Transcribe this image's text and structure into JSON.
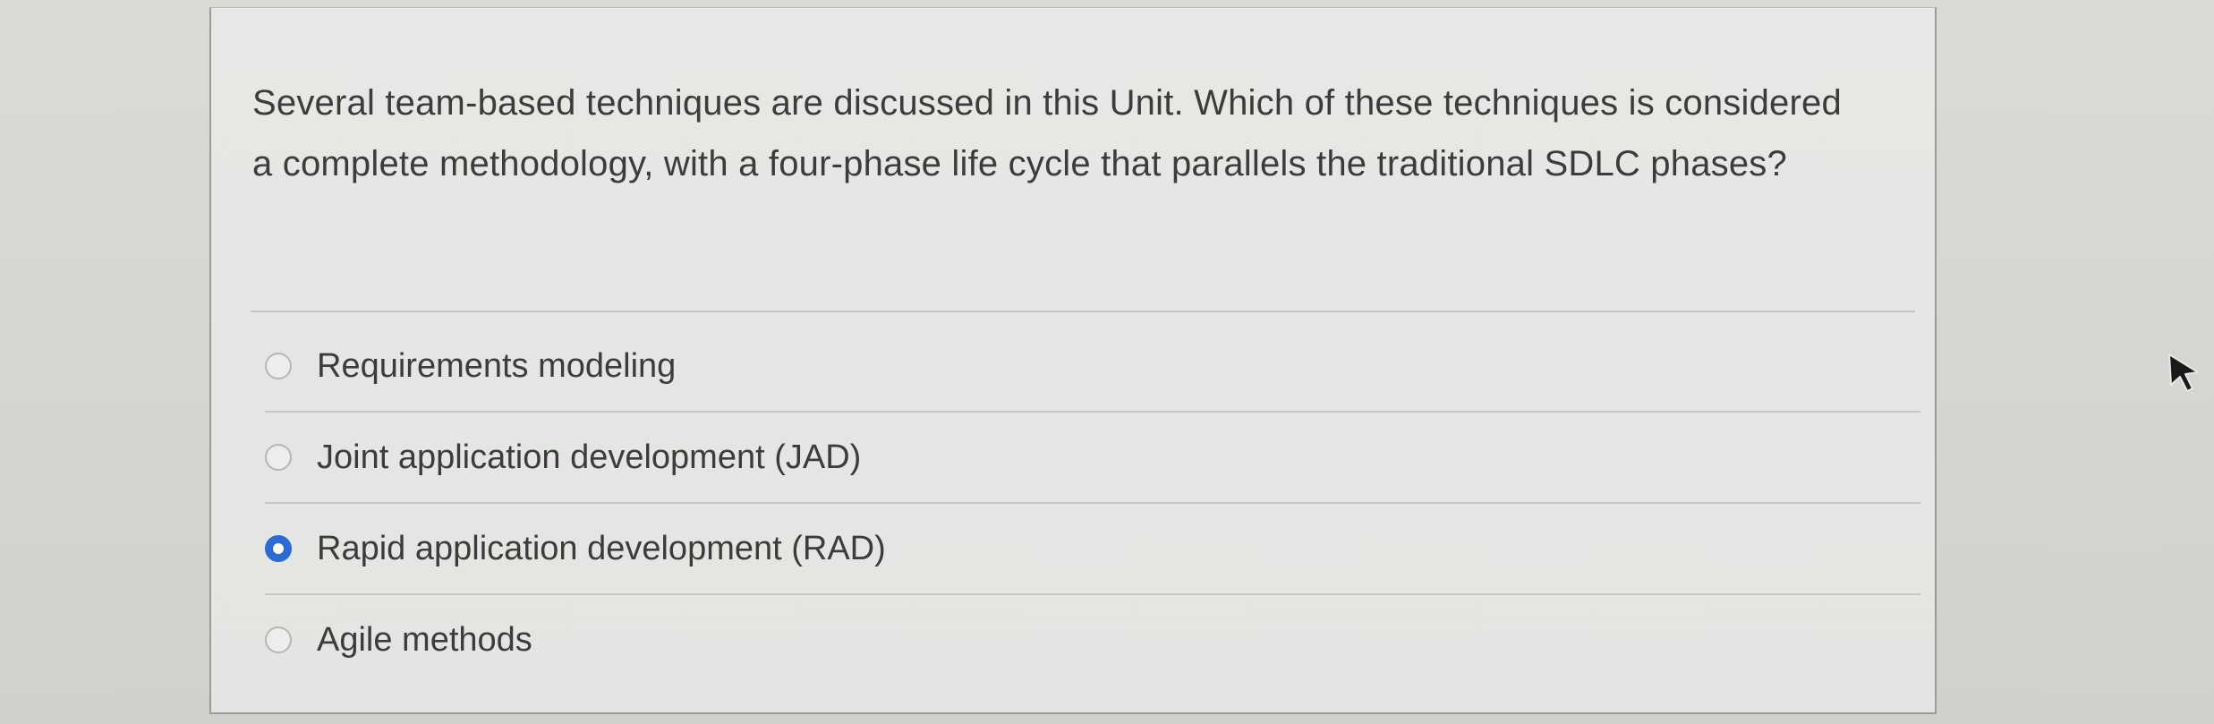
{
  "question": {
    "text": "Several team-based techniques are discussed in this Unit. Which of these techniques is considered a complete methodology, with a four-phase life cycle that parallels the traditional SDLC phases?"
  },
  "answers": [
    {
      "label": "Requirements modeling",
      "selected": false
    },
    {
      "label": "Joint application development (JAD)",
      "selected": false
    },
    {
      "label": "Rapid application development (RAD)",
      "selected": true
    },
    {
      "label": "Agile methods",
      "selected": false
    }
  ],
  "colors": {
    "selected_radio": "#2c6ad6",
    "text": "#3b3c3b"
  },
  "icons": {
    "cursor": "mouse-pointer-icon"
  }
}
